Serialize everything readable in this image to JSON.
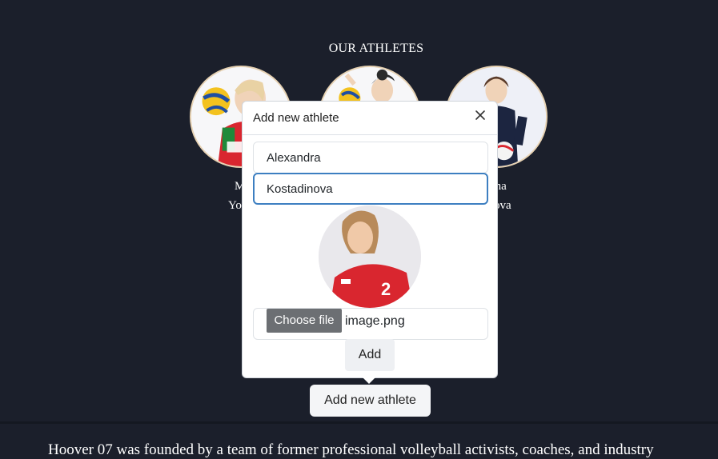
{
  "section": {
    "title": "OUR ATHLETES"
  },
  "athletes": [
    {
      "first_name": "Ma",
      "last_name": "Yorda"
    },
    {
      "first_name": "",
      "last_name": ""
    },
    {
      "first_name": "ona",
      "last_name": "olova"
    }
  ],
  "popover": {
    "title": "Add new athlete",
    "first_name_value": "Alexandra",
    "last_name_value": "Kostadinova",
    "file_button_label": "Choose file",
    "file_name": "image.png",
    "submit_label": "Add"
  },
  "add_button_label": "Add new athlete",
  "about_text": "Hoover 07 was founded by a team of former professional volleyball activists, coaches, and industry",
  "colors": {
    "page_background": "#1b1f2b",
    "photo_border": "#e7d2b3",
    "focus_border": "#3d7fc1",
    "jersey_red": "#d9262f"
  }
}
